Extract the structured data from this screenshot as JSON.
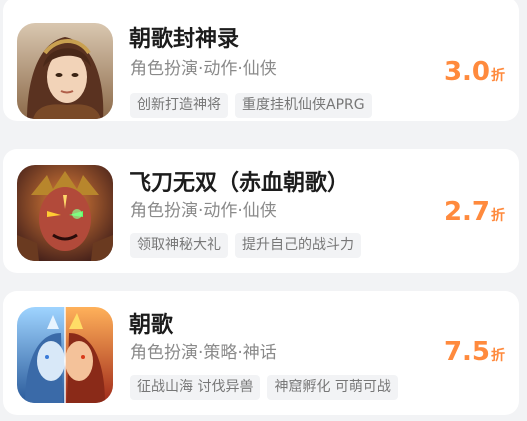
{
  "games": [
    {
      "title": "朝歌封神录",
      "genre": "角色扮演·动作·仙侠",
      "tags": [
        "创新打造神将",
        "重度挂机仙侠APRG"
      ],
      "discount": "3.0",
      "discount_unit": "折",
      "icon": "game-avatar-brown-haired-warrior"
    },
    {
      "title": "飞刀无双（赤血朝歌）",
      "genre": "角色扮演·动作·仙侠",
      "tags": [
        "领取神秘大礼",
        "提升自己的战斗力"
      ],
      "discount": "2.7",
      "discount_unit": "折",
      "icon": "game-avatar-red-demon-warrior"
    },
    {
      "title": "朝歌",
      "genre": "角色扮演·策略·神话",
      "tags": [
        "征战山海 讨伐异兽",
        "神窟孵化 可萌可战"
      ],
      "discount": "7.5",
      "discount_unit": "折",
      "icon": "game-avatar-ice-fire-duo"
    }
  ],
  "colors": {
    "discount": "#ff8a3d",
    "title": "#1c1c1c",
    "genre": "#8a8a8a",
    "tag_bg": "#f2f3f5",
    "page_bg": "#f2f3f5"
  }
}
